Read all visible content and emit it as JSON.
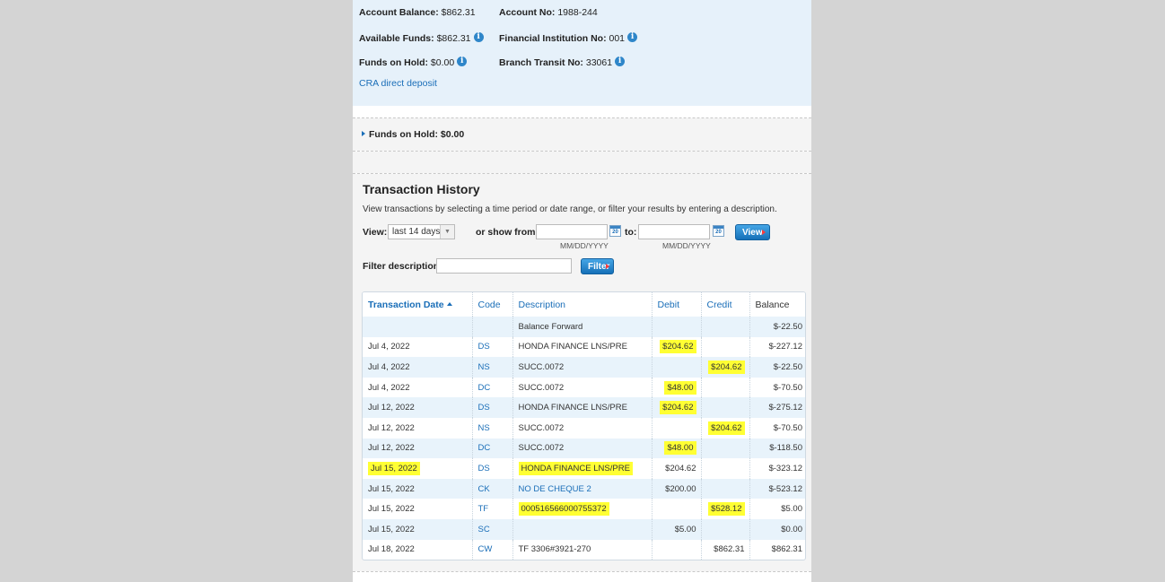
{
  "summary": {
    "account_balance_label": "Account Balance:",
    "account_balance": "$862.31",
    "account_no_label": "Account No:",
    "account_no": "1988-244",
    "available_funds_label": "Available Funds:",
    "available_funds": "$862.31",
    "institution_no_label": "Financial Institution No:",
    "institution_no": "001",
    "funds_on_hold_label": "Funds on Hold:",
    "funds_on_hold": "$0.00",
    "branch_transit_label": "Branch Transit No:",
    "branch_transit": "33061",
    "cra_link": "CRA direct deposit"
  },
  "hold_section": {
    "label": "Funds on Hold: $0.00"
  },
  "history": {
    "title": "Transaction History",
    "description": "View transactions by selecting a time period or date range, or filter your results by entering a description.",
    "view_label": "View:",
    "view_selected": "last 14 days",
    "show_from_label": "or show from:",
    "to_label": "to:",
    "date_hint": "MM/DD/YYYY",
    "calendar_icon_text": "20",
    "view_button": "View",
    "filter_label": "Filter description:",
    "filter_button": "Filter"
  },
  "table": {
    "headers": [
      "Transaction Date",
      "Code",
      "Description",
      "Debit",
      "Credit",
      "Balance"
    ],
    "rows": [
      {
        "date": "",
        "code": "",
        "desc": "Balance Forward",
        "debit": "",
        "credit": "",
        "balance": "$-22.50"
      },
      {
        "date": "Jul 4, 2022",
        "code": "DS",
        "desc": "HONDA FINANCE LNS/PRE",
        "debit": "$204.62",
        "credit": "",
        "balance": "$-227.12"
      },
      {
        "date": "Jul 4, 2022",
        "code": "NS",
        "desc": "SUCC.0072",
        "debit": "",
        "credit": "$204.62",
        "balance": "$-22.50"
      },
      {
        "date": "Jul 4, 2022",
        "code": "DC",
        "desc": "SUCC.0072",
        "debit": "$48.00",
        "credit": "",
        "balance": "$-70.50"
      },
      {
        "date": "Jul 12, 2022",
        "code": "DS",
        "desc": "HONDA FINANCE LNS/PRE",
        "debit": "$204.62",
        "credit": "",
        "balance": "$-275.12"
      },
      {
        "date": "Jul 12, 2022",
        "code": "NS",
        "desc": "SUCC.0072",
        "debit": "",
        "credit": "$204.62",
        "balance": "$-70.50"
      },
      {
        "date": "Jul 12, 2022",
        "code": "DC",
        "desc": "SUCC.0072",
        "debit": "$48.00",
        "credit": "",
        "balance": "$-118.50"
      },
      {
        "date": "Jul 15, 2022",
        "code": "DS",
        "desc": "HONDA FINANCE LNS/PRE",
        "debit": "$204.62",
        "credit": "",
        "balance": "$-323.12"
      },
      {
        "date": "Jul 15, 2022",
        "code": "CK",
        "desc": "NO DE CHEQUE 2",
        "debit": "$200.00",
        "credit": "",
        "balance": "$-523.12"
      },
      {
        "date": "Jul 15, 2022",
        "code": "TF",
        "desc": "000516566000755372",
        "debit": "",
        "credit": "$528.12",
        "balance": "$5.00"
      },
      {
        "date": "Jul 15, 2022",
        "code": "SC",
        "desc": "",
        "debit": "$5.00",
        "credit": "",
        "balance": "$0.00"
      },
      {
        "date": "Jul 18, 2022",
        "code": "CW",
        "desc": "TF 3306#3921-270",
        "debit": "",
        "credit": "$862.31",
        "balance": "$862.31"
      }
    ]
  },
  "colors": {
    "highlight": "#ffff33",
    "link": "#1a6eb8",
    "summary_bg": "#e6f1fa"
  }
}
